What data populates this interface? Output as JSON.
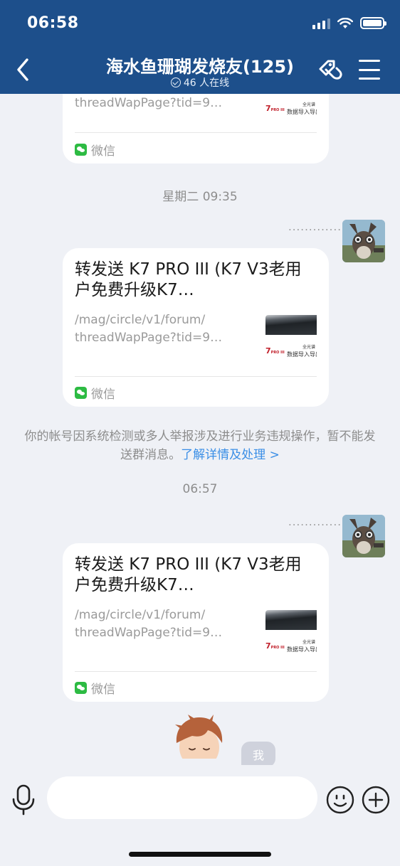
{
  "status_bar": {
    "time": "06:58"
  },
  "header": {
    "title": "海水鱼珊瑚发烧友(125)",
    "online": "46 人在线",
    "icons": {
      "back": "chevron-left-icon",
      "tag": "link-tag-icon",
      "menu": "hamburger-menu-icon"
    }
  },
  "messages": [
    {
      "type": "link_card",
      "title": "",
      "description": "threadWapPage?tid=9…",
      "source": "微信",
      "thumbnail": {
        "brand": "7",
        "brand_small": "PRO III",
        "caption_top": "全光谱",
        "caption_bottom": "数据导入导出"
      }
    },
    {
      "type": "timestamp",
      "text": "星期二 09:35"
    },
    {
      "type": "link_card",
      "sender_name": "..............",
      "title": "转发送 K7 PRO III (K7 V3老用户免费升级K7…",
      "description_line1": "/mag/circle/v1/forum/",
      "description_line2": "threadWapPage?tid=9…",
      "source": "微信",
      "thumbnail": {
        "brand": "7",
        "brand_small": "PRO III",
        "caption_top": "全光谱",
        "caption_bottom": "数据导入导出"
      }
    },
    {
      "type": "system",
      "text": "你的帐号因系统检测或多人举报涉及进行业务违规操作，暂不能发送群消息。",
      "link": "了解详情及处理 >"
    },
    {
      "type": "timestamp",
      "text": "06:57"
    },
    {
      "type": "link_card",
      "sender_name": "..............",
      "title": "转发送 K7 PRO III (K7 V3老用户免费升级K7…",
      "description_line1": "/mag/circle/v1/forum/",
      "description_line2": "threadWapPage?tid=9…",
      "source": "微信",
      "thumbnail": {
        "brand": "7",
        "brand_small": "PRO III",
        "caption_top": "全光谱",
        "caption_bottom": "数据导入导出"
      }
    }
  ],
  "me_bubble": "我",
  "input_bar": {
    "placeholder": "",
    "icons": {
      "voice": "microphone-icon",
      "emoji": "smiley-icon",
      "more": "plus-circle-icon"
    }
  },
  "colors": {
    "header_bg": "#1d4f8b",
    "chat_bg": "#eff1f6",
    "link": "#3a8ee6",
    "wechat": "#2dbb43"
  }
}
